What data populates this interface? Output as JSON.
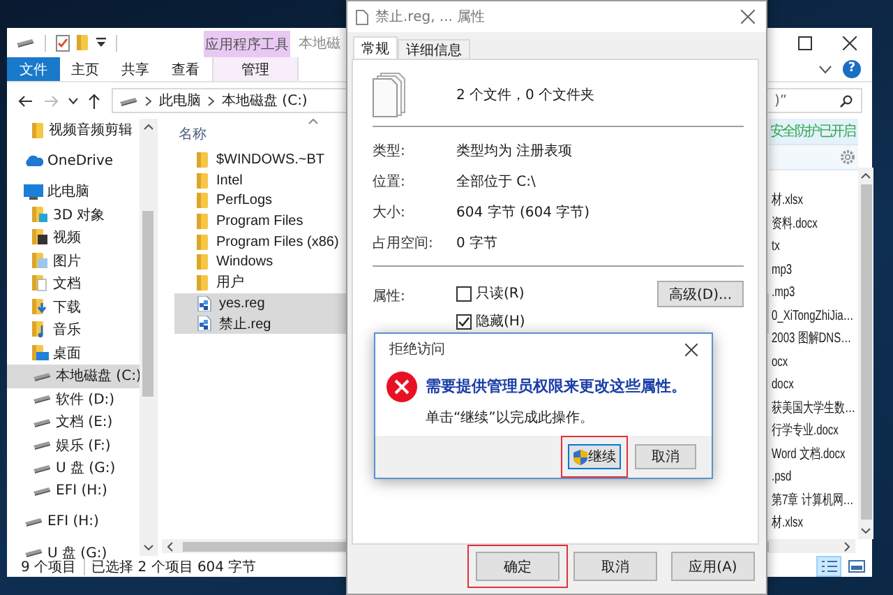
{
  "explorer": {
    "title": "本地磁",
    "context_tab": "应用程序工具",
    "ribbon_tabs": [
      {
        "label": "文件",
        "selected": true
      },
      {
        "label": "主页",
        "selected": false
      },
      {
        "label": "共享",
        "selected": false
      },
      {
        "label": "查看",
        "selected": false
      },
      {
        "label": "管理",
        "selected": false
      }
    ],
    "help": "?",
    "breadcrumb": [
      "此电脑",
      "本地磁盘 (C:)"
    ],
    "search_text": ")”",
    "nav": [
      {
        "label": "视频音频剪辑",
        "kind": "folder",
        "selected": false
      },
      {
        "label": "OneDrive",
        "kind": "cloud",
        "selected": false
      },
      {
        "label": "此电脑",
        "kind": "pc",
        "selected": false,
        "children": [
          {
            "label": "3D 对象",
            "kind": "cube",
            "selected": false
          },
          {
            "label": "视频",
            "kind": "video",
            "selected": false
          },
          {
            "label": "图片",
            "kind": "picture",
            "selected": false
          },
          {
            "label": "文档",
            "kind": "document",
            "selected": false
          },
          {
            "label": "下载",
            "kind": "download",
            "selected": false
          },
          {
            "label": "音乐",
            "kind": "music",
            "selected": false
          },
          {
            "label": "桌面",
            "kind": "desktop",
            "selected": false
          },
          {
            "label": "本地磁盘 (C:)",
            "kind": "drive",
            "selected": true
          },
          {
            "label": "软件 (D:)",
            "kind": "drive",
            "selected": false
          },
          {
            "label": "文档 (E:)",
            "kind": "drive",
            "selected": false
          },
          {
            "label": "娱乐 (F:)",
            "kind": "drive",
            "selected": false
          },
          {
            "label": "U 盘 (G:)",
            "kind": "drive",
            "selected": false
          },
          {
            "label": "EFI (H:)",
            "kind": "drive",
            "selected": false
          }
        ]
      },
      {
        "label": "EFI (H:)",
        "kind": "drive",
        "selected": false
      },
      {
        "label": "U 盘 (G:)",
        "kind": "drive",
        "selected": false
      }
    ],
    "column_header": "名称",
    "files": [
      {
        "name": "$WINDOWS.~BT",
        "kind": "folder",
        "selected": false
      },
      {
        "name": "Intel",
        "kind": "folder",
        "selected": false
      },
      {
        "name": "PerfLogs",
        "kind": "folder",
        "selected": false
      },
      {
        "name": "Program Files",
        "kind": "folder",
        "selected": false
      },
      {
        "name": "Program Files (x86)",
        "kind": "folder",
        "selected": false
      },
      {
        "name": "Windows",
        "kind": "folder",
        "selected": false
      },
      {
        "name": "用户",
        "kind": "folder",
        "selected": false
      },
      {
        "name": "yes.reg",
        "kind": "reg",
        "selected": true
      },
      {
        "name": "禁止.reg",
        "kind": "reg",
        "selected": true
      }
    ],
    "security_banner": "安全防护已开启",
    "side_files": [
      "材.xlsx",
      "资料.docx",
      "tx",
      "mp3",
      ".mp3",
      "0_XiTongZhiJia…",
      "2003 图解DNS…",
      "ocx",
      "docx",
      "获美国大学生数…",
      "行学专业.docx",
      "Word 文档.docx",
      ".psd",
      "第7章 计算机网…",
      "材.xlsx"
    ],
    "status": {
      "count": "9 个项目",
      "selection": "已选择 2 个项目  604 字节"
    }
  },
  "properties": {
    "title": "禁止.reg, ... 属性",
    "tabs": [
      {
        "label": "常规",
        "selected": true
      },
      {
        "label": "详细信息",
        "selected": false
      }
    ],
    "summary": "2 个文件，0 个文件夹",
    "fields": [
      {
        "label": "类型:",
        "value": "类型均为 注册表项"
      },
      {
        "label": "位置:",
        "value": "全部位于 C:\\"
      },
      {
        "label": "大小:",
        "value": "604 字节 (604 字节)"
      },
      {
        "label": "占用空间:",
        "value": "0 字节"
      }
    ],
    "attributes_label": "属性:",
    "checkboxes": [
      {
        "label": "只读(R)",
        "checked": false
      },
      {
        "label": "隐藏(H)",
        "checked": true
      }
    ],
    "advanced_button": "高级(D)...",
    "buttons": [
      {
        "label": "确定",
        "highlighted": true
      },
      {
        "label": "取消",
        "highlighted": false
      },
      {
        "label": "应用(A)",
        "highlighted": false
      }
    ]
  },
  "alert": {
    "title": "拒绝访问",
    "heading": "需要提供管理员权限来更改这些属性。",
    "message": "单击“继续”以完成此操作。",
    "buttons": [
      {
        "label": "继续",
        "kind": "elevated",
        "highlighted": true
      },
      {
        "label": "取消",
        "kind": "plain",
        "highlighted": false
      }
    ]
  }
}
